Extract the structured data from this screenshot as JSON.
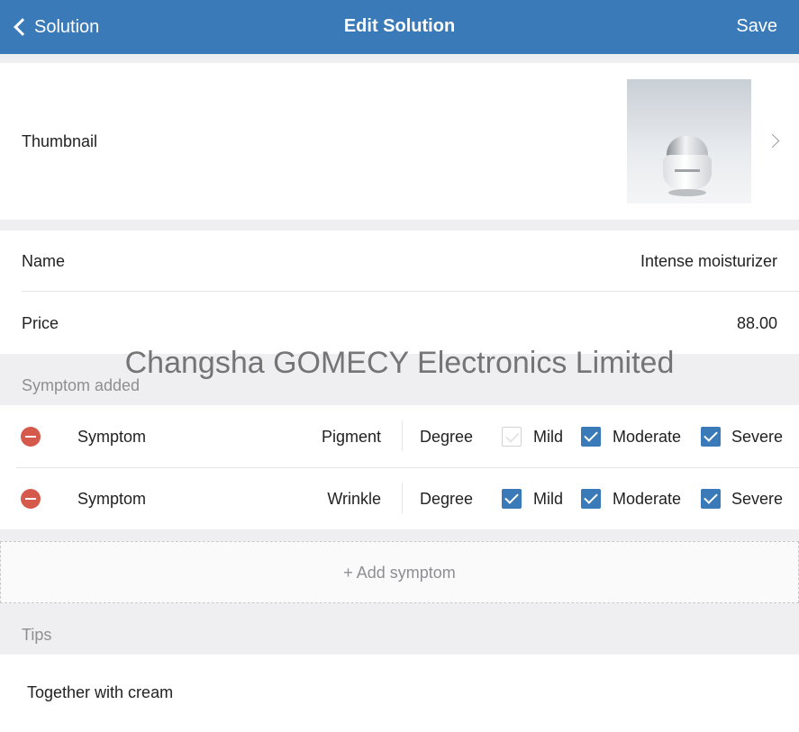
{
  "nav": {
    "back_label": "Solution",
    "title": "Edit Solution",
    "save_label": "Save"
  },
  "thumbnail": {
    "label": "Thumbnail",
    "image": "cream-jar-product-photo",
    "chevron_icon": "chevron-right-icon"
  },
  "fields": {
    "name_label": "Name",
    "name_value": "Intense moisturizer",
    "price_label": "Price",
    "price_value": "88.00"
  },
  "watermark": "Changsha GOMECY Electronics Limited",
  "symptoms": {
    "header": "Symptom added",
    "items": [
      {
        "label": "Symptom",
        "name": "Pigment",
        "degree_label": "Degree",
        "options": [
          {
            "label": "Mild",
            "checked": false
          },
          {
            "label": "Moderate",
            "checked": true
          },
          {
            "label": "Severe",
            "checked": true
          }
        ]
      },
      {
        "label": "Symptom",
        "name": "Wrinkle",
        "degree_label": "Degree",
        "options": [
          {
            "label": "Mild",
            "checked": true
          },
          {
            "label": "Moderate",
            "checked": true
          },
          {
            "label": "Severe",
            "checked": true
          }
        ]
      }
    ],
    "add_label": "+ Add symptom"
  },
  "tips": {
    "header": "Tips",
    "text": "Together with cream"
  },
  "colors": {
    "nav_bar": "#3a7ab8",
    "checkbox_checked": "#3a7ab8",
    "remove_button": "#d55a4b",
    "section_bg": "#efeff1"
  }
}
